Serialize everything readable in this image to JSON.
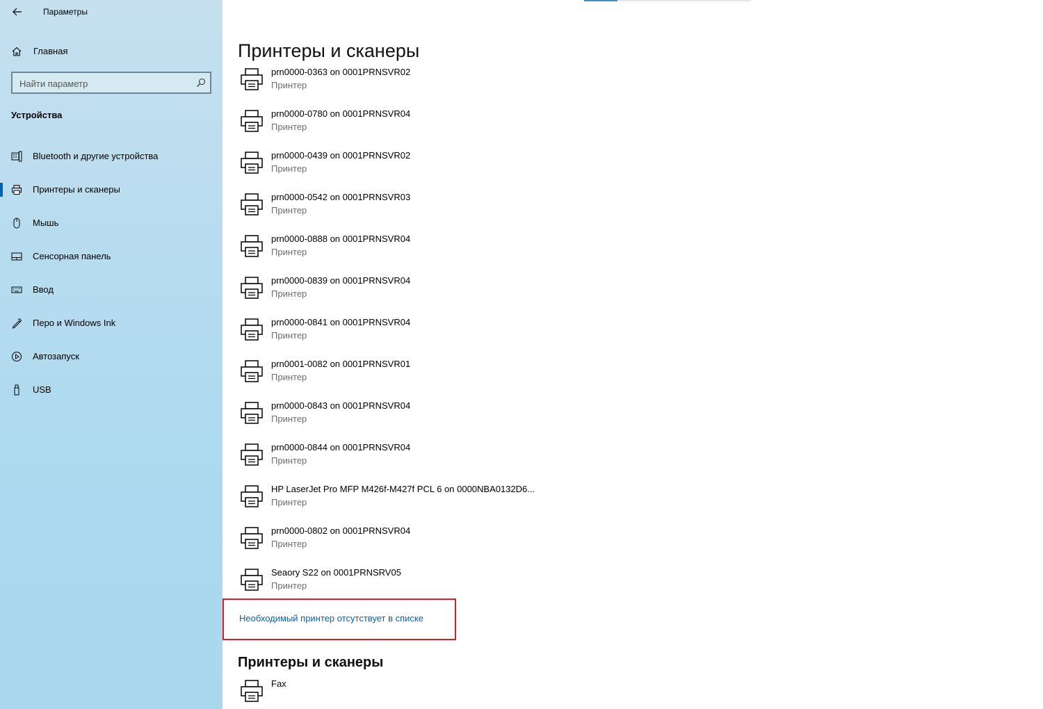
{
  "window": {
    "title": "Параметры"
  },
  "sidebar": {
    "home_label": "Главная",
    "search": {
      "placeholder": "Найти параметр"
    },
    "section_heading": "Устройства",
    "items": [
      {
        "label": "Bluetooth и другие устройства",
        "icon": "bluetooth-devices-icon"
      },
      {
        "label": "Принтеры и сканеры",
        "icon": "printer-icon",
        "selected": true
      },
      {
        "label": "Мышь",
        "icon": "mouse-icon"
      },
      {
        "label": "Сенсорная панель",
        "icon": "touchpad-icon"
      },
      {
        "label": "Ввод",
        "icon": "keyboard-icon"
      },
      {
        "label": "Перо и Windows Ink",
        "icon": "pen-icon"
      },
      {
        "label": "Автозапуск",
        "icon": "autoplay-icon"
      },
      {
        "label": "USB",
        "icon": "usb-icon"
      }
    ]
  },
  "main": {
    "title": "Принтеры и сканеры",
    "printers": [
      {
        "name": "prn0000-0363 on 0001PRNSVR02",
        "type": "Принтер"
      },
      {
        "name": "prn0000-0780 on 0001PRNSVR04",
        "type": "Принтер"
      },
      {
        "name": "prn0000-0439 on 0001PRNSVR02",
        "type": "Принтер"
      },
      {
        "name": "prn0000-0542 on 0001PRNSVR03",
        "type": "Принтер"
      },
      {
        "name": "prn0000-0888 on 0001PRNSVR04",
        "type": "Принтер"
      },
      {
        "name": "prn0000-0839 on 0001PRNSVR04",
        "type": "Принтер"
      },
      {
        "name": "prn0000-0841 on 0001PRNSVR04",
        "type": "Принтер"
      },
      {
        "name": "prn0001-0082 on 0001PRNSVR01",
        "type": "Принтер"
      },
      {
        "name": "prn0000-0843 on 0001PRNSVR04",
        "type": "Принтер"
      },
      {
        "name": "prn0000-0844 on 0001PRNSVR04",
        "type": "Принтер"
      },
      {
        "name": "HP LaserJet Pro MFP M426f-M427f PCL 6 on 0000NBA0132D6...",
        "type": "Принтер"
      },
      {
        "name": "prn0000-0802 on 0001PRNSVR04",
        "type": "Принтер"
      },
      {
        "name": "Seaory S22 on 0001PRNSRV05",
        "type": "Принтер"
      }
    ],
    "missing_printer_link": "Необходимый принтер отсутствует в списке",
    "local_section_title": "Принтеры и сканеры",
    "local_printers": [
      {
        "name": "Fax"
      }
    ],
    "accent_color": "#0063b1",
    "highlight_color": "#e01b24"
  }
}
